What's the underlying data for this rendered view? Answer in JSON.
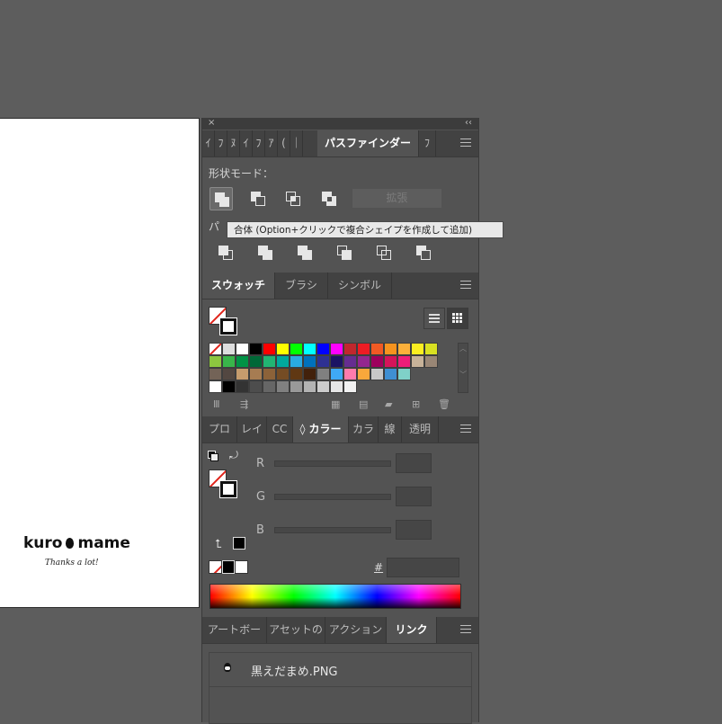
{
  "artboard": {
    "brand_left": "kuro",
    "brand_right": "mame",
    "tagline": "Thanks a lot!"
  },
  "dock": {
    "close_glyph": "×",
    "collapse_glyph": "‹‹"
  },
  "pathfinder_panel": {
    "tabs": [
      "ｲ",
      "ﾌ",
      "ﾇ",
      "ｲ",
      "ﾌ",
      "ｱ",
      "(",
      "｜",
      "パスファインダー",
      "ﾌ"
    ],
    "active_tab": "パスファインダー",
    "shape_modes_label": "形状モード：",
    "expand_button": "拡張",
    "pathfinders_label": "パ",
    "tooltip": "合体 (Option+クリックで複合シェイプを作成して追加)"
  },
  "swatches_panel": {
    "tabs": [
      "スウォッチ",
      "ブラシ",
      "シンボル"
    ],
    "active_tab": "スウォッチ",
    "colors": {
      "row1": [
        "#ffffff",
        "#000000",
        "#ff0000",
        "#ffff00",
        "#00ff00",
        "#00ffff",
        "#0000ff",
        "#ff00ff",
        "#c1272d",
        "#ed1c24",
        "#f15a24",
        "#f7931e",
        "#fbb03b",
        "#fcee21",
        "#d9e021"
      ],
      "row2": [
        "#8cc63f",
        "#39b54a",
        "#009245",
        "#006837",
        "#22b573",
        "#00a99d",
        "#29abe2",
        "#0071bc",
        "#2e3192",
        "#1b1464",
        "#662d91",
        "#93278f",
        "#9e005d",
        "#d4145a",
        "#ed1e79",
        "#c7b299",
        "#998675"
      ],
      "row3": [
        "#736357",
        "#534741",
        "#c69c6d",
        "#a67c52",
        "#8c6239",
        "#754c24",
        "#603813",
        "#42210b",
        "#808080",
        "#3fa9f5",
        "#ff7bac",
        "#f9a83b",
        "#c8c8c8",
        "#3f8fd2",
        "#7fd1c8"
      ]
    }
  },
  "color_panel": {
    "tabs": [
      "プロ",
      "レイ",
      "CC",
      "◊ カラー",
      "カラ",
      "線",
      "透明"
    ],
    "active_tab": "◊ カラー",
    "channels": [
      "R",
      "G",
      "B"
    ],
    "hex_label": "#"
  },
  "links_panel": {
    "tabs": [
      "アートボー",
      "アセットの",
      "アクション",
      "リンク"
    ],
    "active_tab": "リンク",
    "items": [
      {
        "name": "黒えだまめ.PNG"
      }
    ]
  }
}
